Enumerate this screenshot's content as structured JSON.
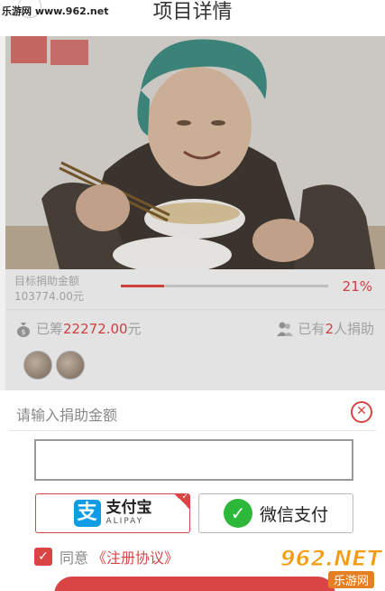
{
  "header": {
    "title": "项目详情",
    "watermark": "乐游网 www.962.net"
  },
  "progress": {
    "target_label": "目标捐助金额",
    "target_amount": "103774.00元",
    "percent_label": "21%",
    "percent_value": 0.21
  },
  "stats": {
    "raised_prefix": "已筹",
    "raised_value": "22272.00",
    "raised_suffix": "元",
    "donors_prefix": "已有",
    "donors_count": "2",
    "donors_suffix": "人捐助"
  },
  "donate": {
    "title": "请输入捐助金额",
    "input_value": "",
    "alipay_cn": "支付宝",
    "alipay_en": "ALIPAY",
    "wechat_label": "微信支付",
    "agree_text": "同意",
    "agree_link": "《注册协议》"
  },
  "logo_watermark": {
    "big": "962.NET",
    "small": "乐游网"
  },
  "colors": {
    "accent": "#d94545",
    "alipay": "#0e9de5",
    "wechat": "#2db839"
  }
}
